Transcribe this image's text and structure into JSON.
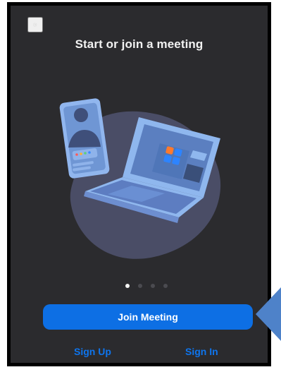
{
  "title": "Start or join a meeting",
  "icons": {
    "settings": "gear-icon",
    "arrow": "pointer-arrow-icon"
  },
  "carousel": {
    "total_pages": 4,
    "active_page": 1
  },
  "actions": {
    "join_label": "Join Meeting",
    "sign_up_label": "Sign Up",
    "sign_in_label": "Sign In"
  },
  "colors": {
    "background": "#2b2b2e",
    "accent": "#0d6fe4",
    "link": "#0e75ee",
    "title": "#f2f2f2",
    "pointer": "#4e82c9"
  }
}
